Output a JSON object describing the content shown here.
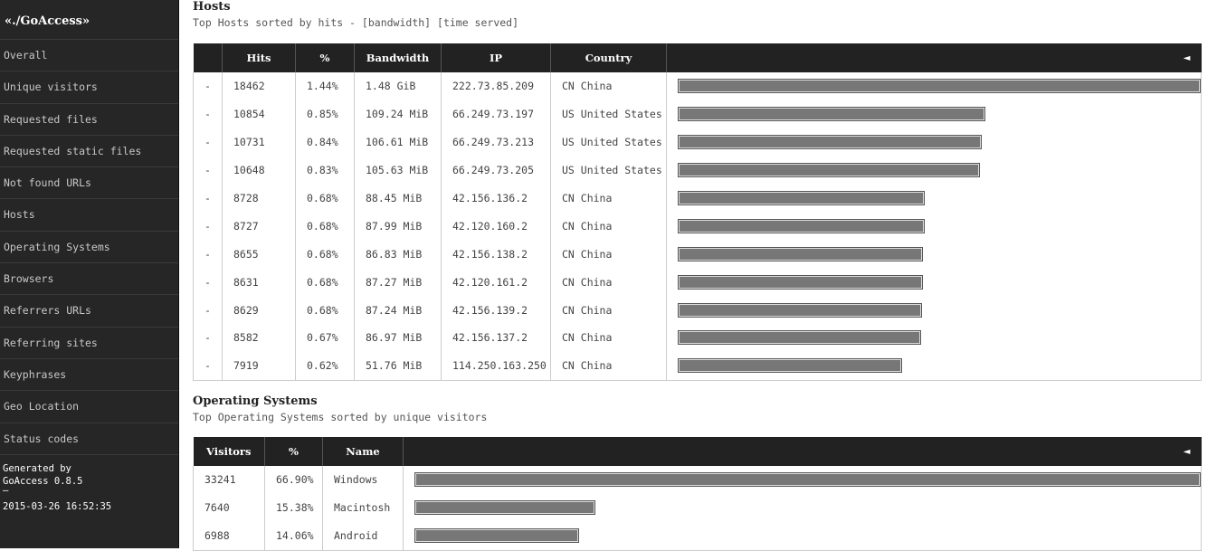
{
  "sidebar": {
    "brand": "«./GoAccess»",
    "items": [
      {
        "label": "Overall"
      },
      {
        "label": "Unique visitors"
      },
      {
        "label": "Requested files"
      },
      {
        "label": "Requested static files"
      },
      {
        "label": "Not found URLs"
      },
      {
        "label": "Hosts"
      },
      {
        "label": "Operating Systems"
      },
      {
        "label": "Browsers"
      },
      {
        "label": "Referrers URLs"
      },
      {
        "label": "Referring sites"
      },
      {
        "label": "Keyphrases"
      },
      {
        "label": "Geo Location"
      },
      {
        "label": "Status codes"
      }
    ],
    "footer": {
      "generated_by": "Generated by",
      "version": "GoAccess 0.8.5",
      "dash": "—",
      "date": "2015-03-26 16:52:35"
    }
  },
  "hosts": {
    "title": "Hosts",
    "subtitle": "Top Hosts sorted by hits - [bandwidth] [time served]",
    "columns": [
      "",
      "Hits",
      "%",
      "Bandwidth",
      "IP",
      "Country"
    ],
    "arrow": "◄",
    "rows": [
      {
        "expand": "-",
        "hits": "18462",
        "pct": "1.44%",
        "bw": "1.48  GiB",
        "ip": "222.73.85.209",
        "country": "CN China",
        "share": 1.0
      },
      {
        "expand": "-",
        "hits": "10854",
        "pct": "0.85%",
        "bw": "109.24  MiB",
        "ip": "66.249.73.197",
        "country": "US United States",
        "share": 0.588
      },
      {
        "expand": "-",
        "hits": "10731",
        "pct": "0.84%",
        "bw": "106.61  MiB",
        "ip": "66.249.73.213",
        "country": "US United States",
        "share": 0.581
      },
      {
        "expand": "-",
        "hits": "10648",
        "pct": "0.83%",
        "bw": "105.63  MiB",
        "ip": "66.249.73.205",
        "country": "US United States",
        "share": 0.577
      },
      {
        "expand": "-",
        "hits": "8728",
        "pct": "0.68%",
        "bw": "88.45  MiB",
        "ip": "42.156.136.2",
        "country": "CN China",
        "share": 0.473
      },
      {
        "expand": "-",
        "hits": "8727",
        "pct": "0.68%",
        "bw": "87.99  MiB",
        "ip": "42.120.160.2",
        "country": "CN China",
        "share": 0.473
      },
      {
        "expand": "-",
        "hits": "8655",
        "pct": "0.68%",
        "bw": "86.83  MiB",
        "ip": "42.156.138.2",
        "country": "CN China",
        "share": 0.469
      },
      {
        "expand": "-",
        "hits": "8631",
        "pct": "0.68%",
        "bw": "87.27  MiB",
        "ip": "42.120.161.2",
        "country": "CN China",
        "share": 0.468
      },
      {
        "expand": "-",
        "hits": "8629",
        "pct": "0.68%",
        "bw": "87.24  MiB",
        "ip": "42.156.139.2",
        "country": "CN China",
        "share": 0.467
      },
      {
        "expand": "-",
        "hits": "8582",
        "pct": "0.67%",
        "bw": "86.97  MiB",
        "ip": "42.156.137.2",
        "country": "CN China",
        "share": 0.465
      },
      {
        "expand": "-",
        "hits": "7919",
        "pct": "0.62%",
        "bw": "51.76  MiB",
        "ip": "114.250.163.250",
        "country": "CN China",
        "share": 0.429
      }
    ]
  },
  "os": {
    "title": "Operating Systems",
    "subtitle": "Top Operating Systems sorted by unique visitors",
    "columns": [
      "Visitors",
      "%",
      "Name"
    ],
    "arrow": "◄",
    "rows": [
      {
        "visitors": "33241",
        "pct": "66.90%",
        "name": "Windows",
        "share": 1.0
      },
      {
        "visitors": "7640",
        "pct": "15.38%",
        "name": "Macintosh",
        "share": 0.23
      },
      {
        "visitors": "6988",
        "pct": "14.06%",
        "name": "Android",
        "share": 0.21
      }
    ]
  }
}
